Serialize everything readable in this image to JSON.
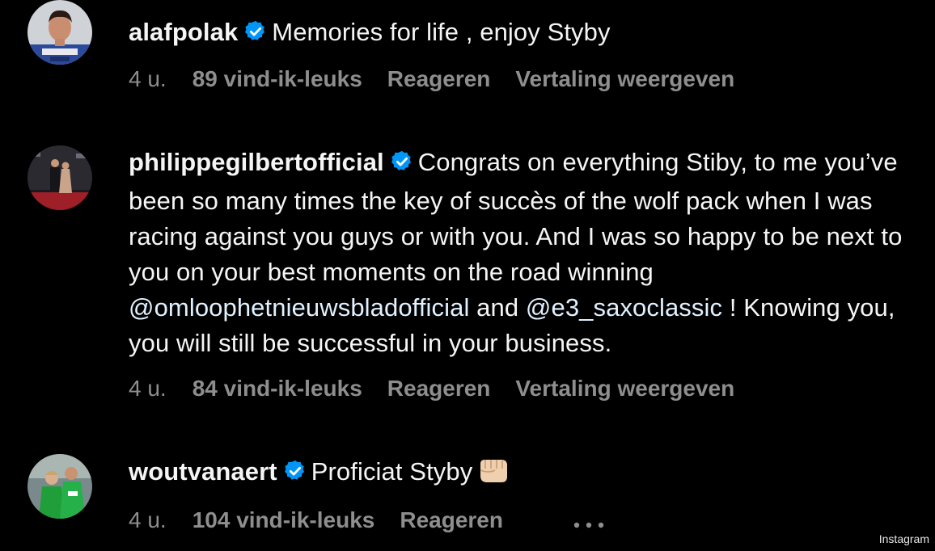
{
  "comments": [
    {
      "username": "alafpolak",
      "verified": true,
      "text": "Memories for life , enjoy Styby",
      "time": "4 u.",
      "likes": "89 vind-ik-leuks",
      "reply": "Reageren",
      "translate": "Vertaling weergeven"
    },
    {
      "username": "philippegilbertofficial",
      "verified": true,
      "text_parts": {
        "p1": "Congrats on everything Stiby, to me you’ve been so many times the key of succès of the wolf pack when I was racing against you guys or with you. And I was so happy to be next to you on your best moments on the road winning ",
        "mention1": "@omloophetnieuwsbladofficial",
        "p2": " and ",
        "mention2": "@e3_saxoclassic",
        "p3": " ! Knowing you, you will still be successful in your business."
      },
      "time": "4 u.",
      "likes": "84 vind-ik-leuks",
      "reply": "Reageren",
      "translate": "Vertaling weergeven"
    },
    {
      "username": "woutvanaert",
      "verified": true,
      "text": "Proficiat Styby",
      "emoji": "oncoming-fist",
      "time": "4 u.",
      "likes": "104 vind-ik-leuks",
      "reply": "Reageren",
      "more": "more-options-icon"
    }
  ],
  "watermark": "Instagram",
  "colors": {
    "background": "#000000",
    "text": "#f5f5f5",
    "meta": "#8e8e8e",
    "verified": "#0095f6",
    "mention": "#e0f1ff"
  }
}
